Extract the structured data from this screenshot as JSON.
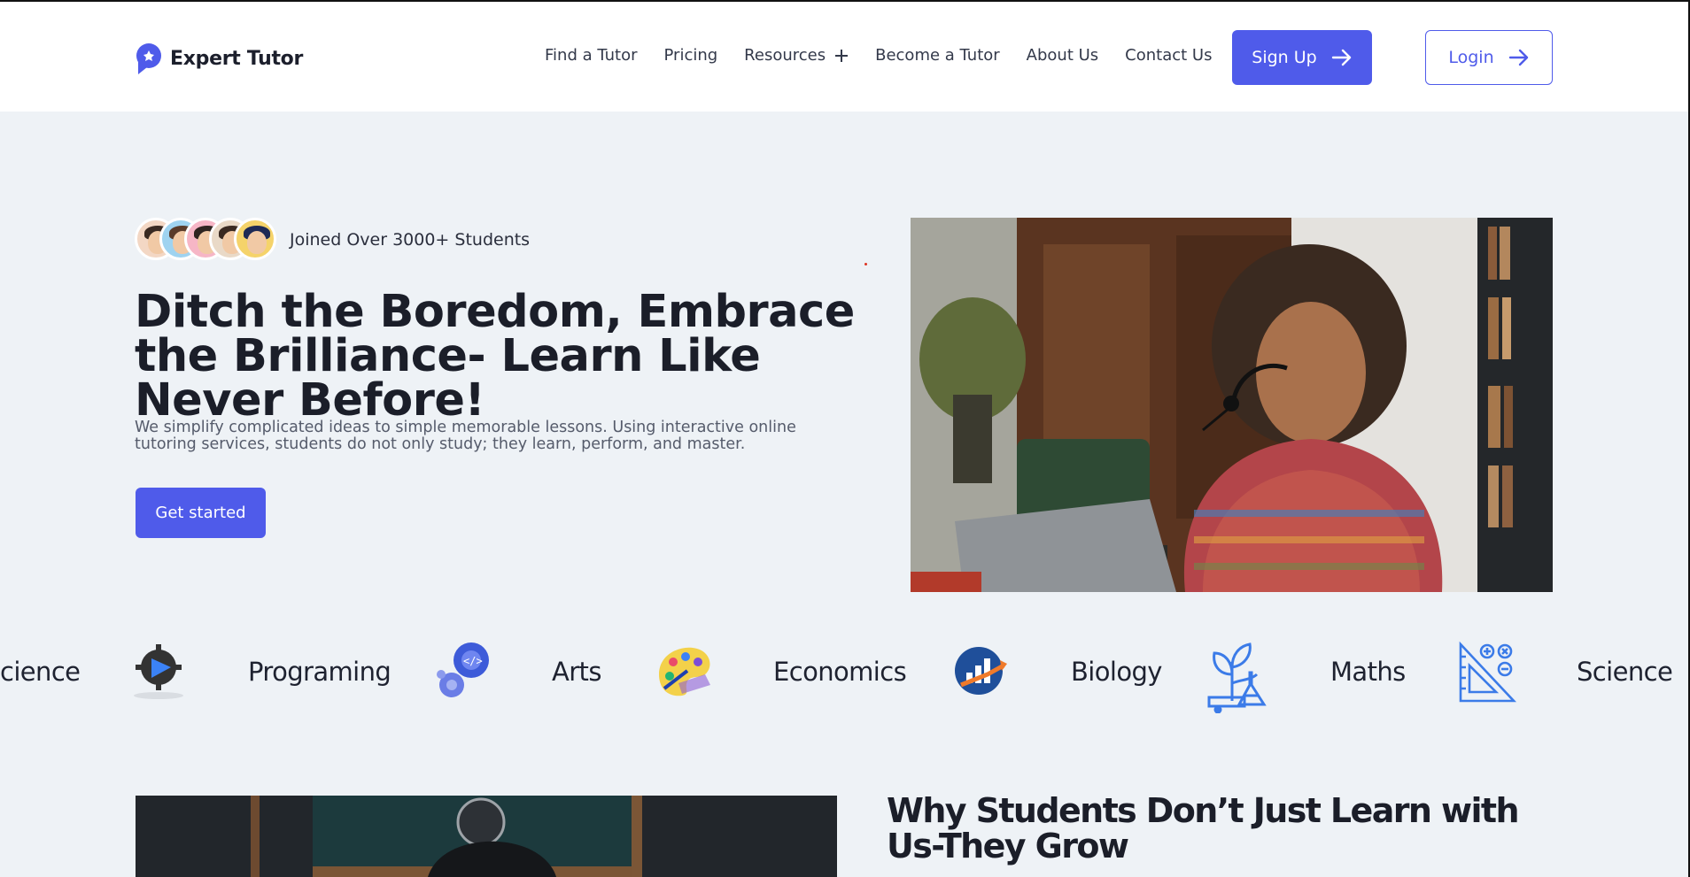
{
  "header": {
    "brand": "Expert Tutor",
    "nav": [
      "Find a Tutor",
      "Pricing",
      "Resources",
      "Become a Tutor",
      "About Us",
      "Contact Us"
    ],
    "signup_label": "Sign Up",
    "login_label": "Login"
  },
  "hero": {
    "joined_text": "Joined Over 3000+ Students",
    "title": "Ditch the Boredom, Embrace the Brilliance- Learn Like Never Before!",
    "description": "We simplify complicated ideas to simple memorable lessons. Using interactive online tutoring services, students do not only study; they learn, perform, and master.",
    "cta_label": "Get started"
  },
  "subjects": {
    "items": [
      "cience",
      "Programing",
      "Arts",
      "Economics",
      "Biology",
      "Maths",
      "Science"
    ],
    "icons": [
      "video-gear-icon",
      "code-gears-icon",
      "paint-palette-icon",
      "economics-chart-icon",
      "biology-plant-flask-icon",
      "maths-ruler-icon"
    ]
  },
  "section": {
    "title": "Why Students Don’t Just Learn with Us-They Grow"
  },
  "colors": {
    "accent": "#4f5bea",
    "background": "#eef2f6",
    "text": "#1b1e29"
  }
}
